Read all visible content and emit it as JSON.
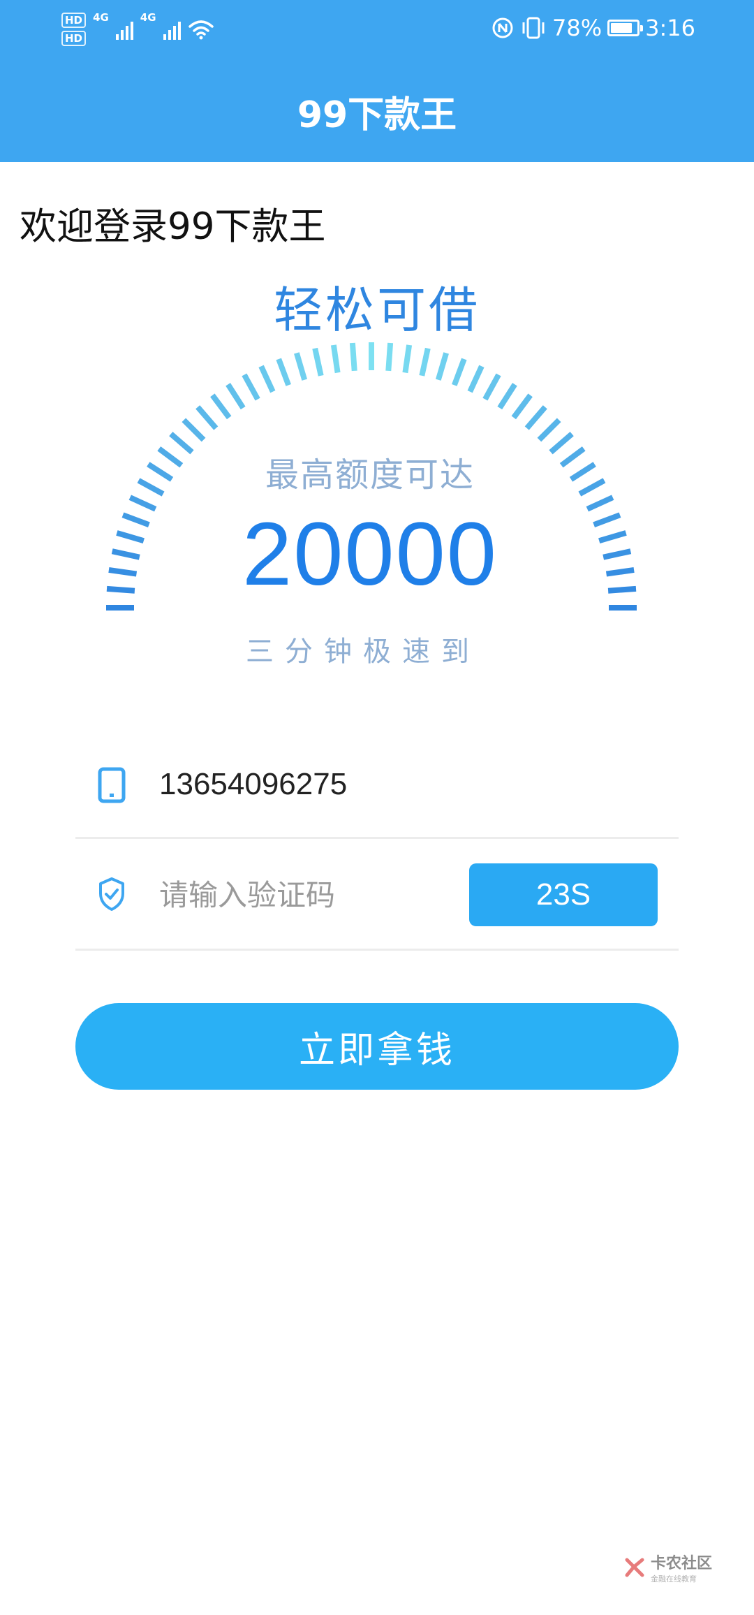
{
  "status_bar": {
    "hd1": "HD",
    "hd2": "HD",
    "net1": "4G",
    "net2": "4G",
    "battery_percent": "78%",
    "time": "3:16",
    "icons": [
      "signal-icon",
      "wifi-icon",
      "nfc-icon",
      "vibrate-icon",
      "battery-icon"
    ]
  },
  "app_bar": {
    "title": "99下款王"
  },
  "welcome": "欢迎登录99下款王",
  "promo": {
    "headline": "轻松可借",
    "limit_label": "最高额度可达",
    "limit_value": "20000",
    "speed_text": "三分钟极速到"
  },
  "form": {
    "phone": {
      "icon": "phone-icon",
      "value": "13654096275"
    },
    "code": {
      "icon": "shield-check-icon",
      "placeholder": "请输入验证码",
      "value": "",
      "countdown_label": "23S"
    },
    "submit_label": "立即拿钱"
  },
  "watermark": {
    "title": "卡农社区",
    "subtitle": "金融在线教育"
  },
  "colors": {
    "app_bar": "#3ea6f1",
    "headline": "#2f86e0",
    "limit_value": "#1f7fe8",
    "muted_text": "#8eaed3",
    "button": "#2ab0f5",
    "countdown_button": "#2aa9f3"
  }
}
